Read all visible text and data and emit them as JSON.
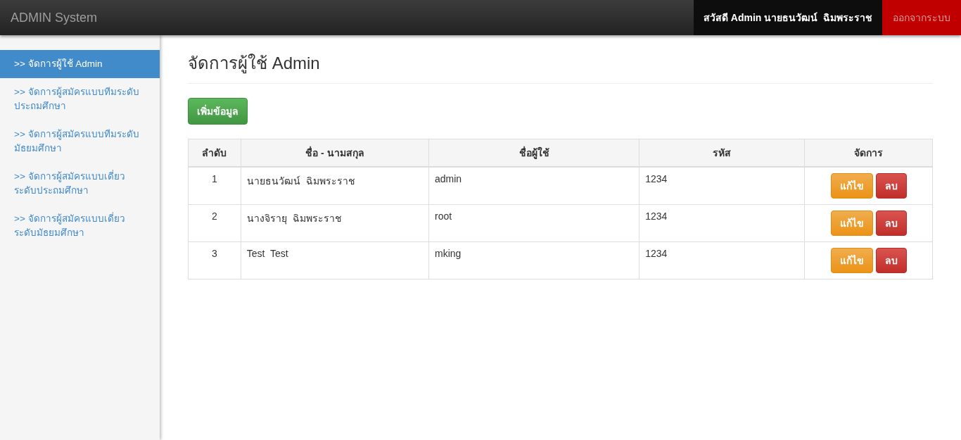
{
  "navbar": {
    "brand": "ADMIN System",
    "greeting": "สวัสดี Admin นายธนวัฒน์  ฉิมพระราช",
    "logout": "ออกจากระบบ"
  },
  "sidebar": {
    "items": [
      {
        "label": ">> จัดการผู้ใช้ Admin",
        "selected": true
      },
      {
        "label": ">> จัดการผู้สมัครแบบทีมระดับประถมศึกษา",
        "selected": false
      },
      {
        "label": ">> จัดการผู้สมัครแบบทีมระดับมัธยมศึกษา",
        "selected": false
      },
      {
        "label": ">> จัดการผู้สมัครแบบเดี่ยวระดับประถมศึกษา",
        "selected": false
      },
      {
        "label": ">> จัดการผู้สมัครแบบเดี่ยวระดับมัธยมศึกษา",
        "selected": false
      }
    ]
  },
  "page_title": "จัดการผู้ใช้ Admin",
  "add_button": "เพิ่มข้อมูล",
  "table": {
    "columns": [
      "ลำดับ",
      "ชื่อ - นามสกุล",
      "ชื่อผู้ใช้",
      "รหัส",
      "จัดการ"
    ],
    "rows": [
      {
        "no": "1",
        "name": "นายธนวัฒน์  ฉิมพระราช",
        "username": "admin",
        "password": "1234",
        "edit": "แก้ไข",
        "delete": "ลบ"
      },
      {
        "no": "2",
        "name": "นางจิรายุ  ฉิมพระราช",
        "username": "root",
        "password": "1234",
        "edit": "แก้ไข",
        "delete": "ลบ"
      },
      {
        "no": "3",
        "name": "Test  Test",
        "username": "mking",
        "password": "1234",
        "edit": "แก้ไข",
        "delete": "ลบ"
      }
    ]
  }
}
